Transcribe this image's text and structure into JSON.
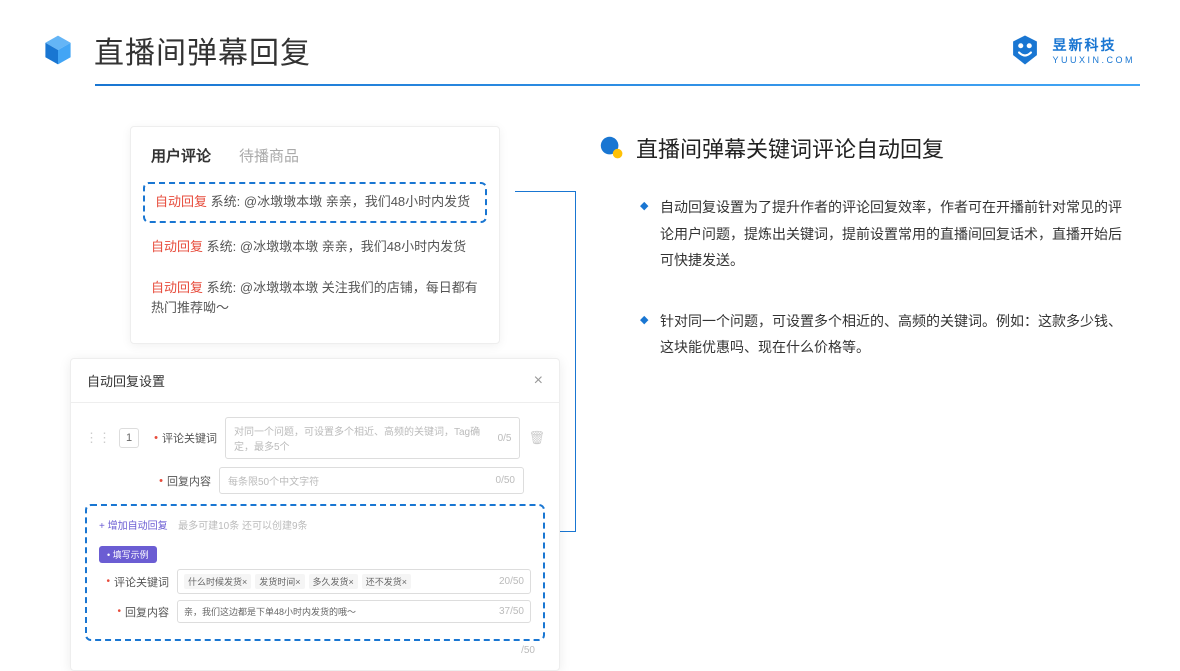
{
  "header": {
    "title": "直播间弹幕回复",
    "brand_cn": "昱新科技",
    "brand_en": "YUUXIN.COM"
  },
  "comments": {
    "tab_active": "用户评论",
    "tab_inactive": "待播商品",
    "items": [
      {
        "tag": "自动回复",
        "sys": "系统:",
        "body": "@冰墩墩本墩 亲亲，我们48小时内发货"
      },
      {
        "tag": "自动回复",
        "sys": "系统:",
        "body": "@冰墩墩本墩 亲亲，我们48小时内发货"
      },
      {
        "tag": "自动回复",
        "sys": "系统:",
        "body": "@冰墩墩本墩 关注我们的店铺，每日都有热门推荐呦～"
      }
    ]
  },
  "settings": {
    "title": "自动回复设置",
    "idx": "1",
    "keyword_label": "评论关键词",
    "keyword_placeholder": "对同一个问题，可设置多个相近、高频的关键词，Tag确定，最多5个",
    "keyword_count": "0/5",
    "content_label": "回复内容",
    "content_placeholder": "每条限50个中文字符",
    "content_count": "0/50",
    "add_text": "+ 增加自动回复",
    "add_hint": "最多可建10条 还可以创建9条",
    "example_badge": "• 填写示例",
    "example_keyword_label": "评论关键词",
    "example_tags": [
      "什么时候发货×",
      "发货时间×",
      "多久发货×",
      "还不发货×"
    ],
    "example_keyword_count": "20/50",
    "example_content_label": "回复内容",
    "example_content_value": "亲，我们这边都是下单48小时内发货的哦～",
    "example_content_count": "37/50",
    "outer_count": "/50"
  },
  "right": {
    "section_title": "直播间弹幕关键词评论自动回复",
    "bullets": [
      "自动回复设置为了提升作者的评论回复效率，作者可在开播前针对常见的评论用户问题，提炼出关键词，提前设置常用的直播间回复话术，直播开始后可快捷发送。",
      "针对同一个问题，可设置多个相近的、高频的关键词。例如：这款多少钱、这块能优惠吗、现在什么价格等。"
    ]
  }
}
